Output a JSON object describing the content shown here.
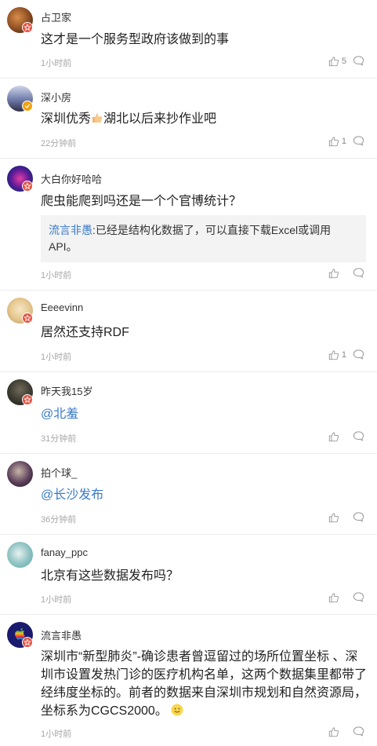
{
  "colors": {
    "mention": "#3a7ac8",
    "badge_red": "#e45546",
    "badge_orange": "#f0a20f",
    "time_gray": "#a7a7a7",
    "quote_bg": "#f3f3f3"
  },
  "comments": [
    {
      "username": "占卫家",
      "text": "这才是一个服务型政府该做到的事",
      "time": "1小时前",
      "likes": "5",
      "badge": "red-badge-icon"
    },
    {
      "username": "深小房",
      "text_before": "深圳优秀",
      "text_after": "湖北以后来抄作业吧",
      "emoji": "thumbs-up-emoji",
      "time": "22分钟前",
      "likes": "1",
      "badge": "orange-verified-badge-icon"
    },
    {
      "username": "大白你好哈哈",
      "text": "爬虫能爬到吗还是一个个官博统计？",
      "quote_name": "流言非愚",
      "quote_text": ":已经是结构化数据了，可以直接下载Excel或调用API。",
      "time": "1小时前",
      "likes": "",
      "badge": "red-badge-icon"
    },
    {
      "username": "Eeeevinn",
      "text": "居然还支持RDF",
      "time": "1小时前",
      "likes": "1",
      "badge": "red-badge-icon"
    },
    {
      "username": "昨天我15岁",
      "text": "@北羞",
      "time": "31分钟前",
      "likes": "",
      "badge": "red-badge-icon"
    },
    {
      "username": "拍个球_",
      "text": "@长沙发布",
      "time": "36分钟前",
      "likes": "",
      "badge": ""
    },
    {
      "username": "fanay_ppc",
      "text": "北京有这些数据发布吗？",
      "time": "1小时前",
      "likes": "",
      "badge": ""
    },
    {
      "username": "流言非愚",
      "text": "深圳市“新型肺炎”-确诊患者曾逗留过的场所位置坐标 、深圳市设置发热门诊的医疗机构名单，这两个数据集里都带了经纬度坐标的。前者的数据来自深圳市规划和自然资源局，坐标系为CGCS2000。",
      "emoji": "smile-emoji",
      "time": "1小时前",
      "likes": "",
      "badge": "red-badge-icon"
    }
  ]
}
